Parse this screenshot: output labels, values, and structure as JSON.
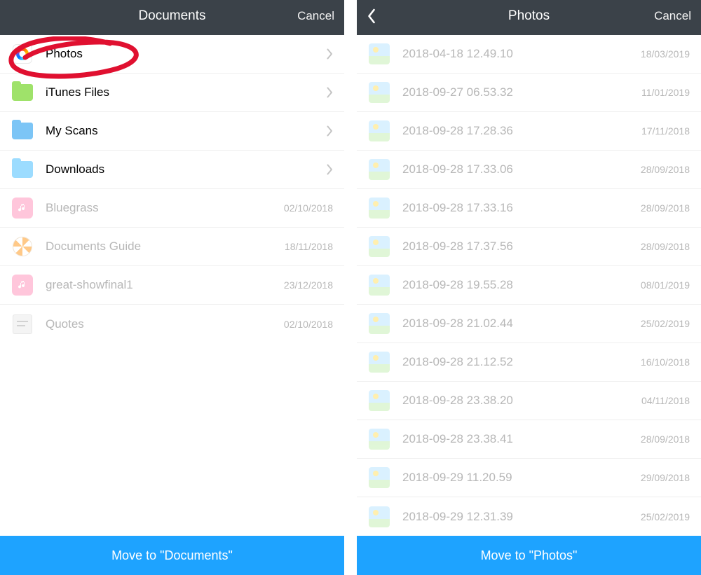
{
  "left": {
    "title": "Documents",
    "cancel": "Cancel",
    "action": "Move to \"Documents\"",
    "items": [
      {
        "label": "Photos",
        "icon": "photos-app",
        "has_chevron": true,
        "meta": "",
        "faded": false
      },
      {
        "label": "iTunes Files",
        "icon": "folder-green",
        "has_chevron": true,
        "meta": "",
        "faded": false
      },
      {
        "label": "My Scans",
        "icon": "folder-bluem",
        "has_chevron": true,
        "meta": "",
        "faded": false
      },
      {
        "label": "Downloads",
        "icon": "folder-blue",
        "has_chevron": true,
        "meta": "",
        "faded": false
      },
      {
        "label": "Bluegrass",
        "icon": "music",
        "has_chevron": false,
        "meta": "02/10/2018",
        "faded": true
      },
      {
        "label": "Documents Guide",
        "icon": "help",
        "has_chevron": false,
        "meta": "18/11/2018",
        "faded": true
      },
      {
        "label": "great-showfinal1",
        "icon": "music",
        "has_chevron": false,
        "meta": "23/12/2018",
        "faded": true
      },
      {
        "label": "Quotes",
        "icon": "text",
        "has_chevron": false,
        "meta": "02/10/2018",
        "faded": true
      }
    ]
  },
  "right": {
    "title": "Photos",
    "cancel": "Cancel",
    "action": "Move to \"Photos\"",
    "items": [
      {
        "label": "2018-04-18 12.49.10",
        "meta": "18/03/2019"
      },
      {
        "label": "2018-09-27 06.53.32",
        "meta": "11/01/2019"
      },
      {
        "label": "2018-09-28 17.28.36",
        "meta": "17/11/2018"
      },
      {
        "label": "2018-09-28 17.33.06",
        "meta": "28/09/2018"
      },
      {
        "label": "2018-09-28 17.33.16",
        "meta": "28/09/2018"
      },
      {
        "label": "2018-09-28 17.37.56",
        "meta": "28/09/2018"
      },
      {
        "label": "2018-09-28 19.55.28",
        "meta": "08/01/2019"
      },
      {
        "label": "2018-09-28 21.02.44",
        "meta": "25/02/2019"
      },
      {
        "label": "2018-09-28 21.12.52",
        "meta": "16/10/2018"
      },
      {
        "label": "2018-09-28 23.38.20",
        "meta": "04/11/2018"
      },
      {
        "label": "2018-09-28 23.38.41",
        "meta": "28/09/2018"
      },
      {
        "label": "2018-09-29 11.20.59",
        "meta": "29/09/2018"
      },
      {
        "label": "2018-09-29 12.31.39",
        "meta": "25/02/2019"
      }
    ]
  },
  "annotation": {
    "target_label": "Photos",
    "color": "#e11"
  }
}
